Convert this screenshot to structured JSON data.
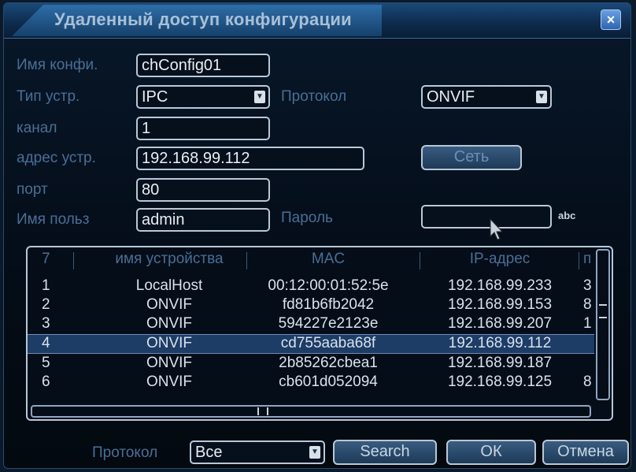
{
  "dialog": {
    "title": "Удаленный доступ конфигурации",
    "close_label": "×"
  },
  "form": {
    "config_name": {
      "label": "Имя конфи.",
      "value": "chConfig01"
    },
    "device_type": {
      "label": "Тип устр.",
      "value": "IPC"
    },
    "protocol": {
      "label": "Протокол",
      "value": "ONVIF"
    },
    "channel": {
      "label": "канал",
      "value": "1"
    },
    "device_address": {
      "label": "адрес устр.",
      "value": "192.168.99.112"
    },
    "set_button": {
      "label": "Сеть"
    },
    "port": {
      "label": "порт",
      "value": "80"
    },
    "username": {
      "label": "Имя польз",
      "value": "admin"
    },
    "password": {
      "label": "Пароль",
      "value": "",
      "abc_label": "abc"
    }
  },
  "device_table": {
    "count": "7",
    "columns": [
      "имя устройства",
      "MAC",
      "IP-адрес",
      "п"
    ],
    "rows": [
      {
        "n": "1",
        "name": "LocalHost",
        "mac": "00:12:00:01:52:5e",
        "ip": "192.168.99.233",
        "port": "3"
      },
      {
        "n": "2",
        "name": "ONVIF",
        "mac": "fd81b6fb2042",
        "ip": "192.168.99.153",
        "port": "8"
      },
      {
        "n": "3",
        "name": "ONVIF",
        "mac": "594227e2123e",
        "ip": "192.168.99.207",
        "port": "1"
      },
      {
        "n": "4",
        "name": "ONVIF",
        "mac": "cd755aaba68f",
        "ip": "192.168.99.112",
        "port": "",
        "selected": true
      },
      {
        "n": "5",
        "name": "ONVIF",
        "mac": "2b85262cbea1",
        "ip": "192.168.99.187",
        "port": ""
      },
      {
        "n": "6",
        "name": "ONVIF",
        "mac": "cb601d052094",
        "ip": "192.168.99.125",
        "port": "8"
      }
    ]
  },
  "footer": {
    "protocol_label": "Протокол",
    "protocol_value": "Все",
    "search_label": "Search",
    "ok_label": "ОК",
    "cancel_label": "Отмена"
  },
  "colors": {
    "label": "#4a6e96",
    "field_text": "#e8eef4",
    "selected_row": "#1d3c66",
    "background": "#040c17"
  }
}
